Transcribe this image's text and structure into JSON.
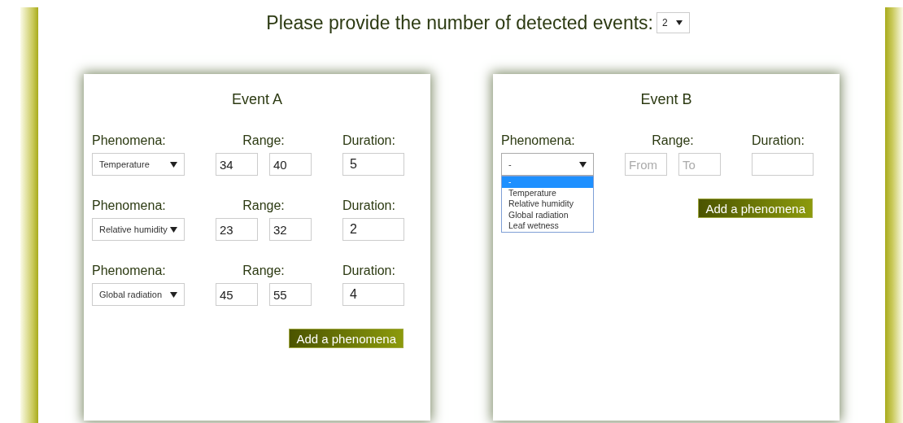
{
  "header": {
    "prompt": "Please provide the number of detected events:",
    "count_select": {
      "value": "2"
    }
  },
  "events": [
    {
      "title": "Event A",
      "rows": [
        {
          "phenomena_label": "Phenomena:",
          "phenomena": {
            "value": "Temperature"
          },
          "range_label": "Range:",
          "from": {
            "value": "34"
          },
          "to": {
            "value": "40"
          },
          "duration_label": "Duration:",
          "duration": {
            "value": "5"
          }
        },
        {
          "phenomena_label": "Phenomena:",
          "phenomena": {
            "value": "Relative humidity"
          },
          "range_label": "Range:",
          "from": {
            "value": "23"
          },
          "to": {
            "value": "32"
          },
          "duration_label": "Duration:",
          "duration": {
            "value": "2"
          }
        },
        {
          "phenomena_label": "Phenomena:",
          "phenomena": {
            "value": "Global radiation"
          },
          "range_label": "Range:",
          "from": {
            "value": "45"
          },
          "to": {
            "value": "55"
          },
          "duration_label": "Duration:",
          "duration": {
            "value": "4"
          }
        }
      ],
      "add_button": "Add a phenomena"
    },
    {
      "title": "Event B",
      "rows": [
        {
          "phenomena_label": "Phenomena:",
          "phenomena": {
            "value": "-",
            "expanded": true,
            "options": [
              {
                "label": "-",
                "selected": true
              },
              {
                "label": "Temperature",
                "selected": false
              },
              {
                "label": "Relative humidity",
                "selected": false
              },
              {
                "label": "Global radiation",
                "selected": false
              },
              {
                "label": "Leaf wetness",
                "selected": false
              }
            ]
          },
          "range_label": "Range:",
          "from": {
            "placeholder": "From"
          },
          "to": {
            "placeholder": "To"
          },
          "duration_label": "Duration:",
          "duration": {}
        }
      ],
      "add_button": "Add a phenomena"
    }
  ]
}
